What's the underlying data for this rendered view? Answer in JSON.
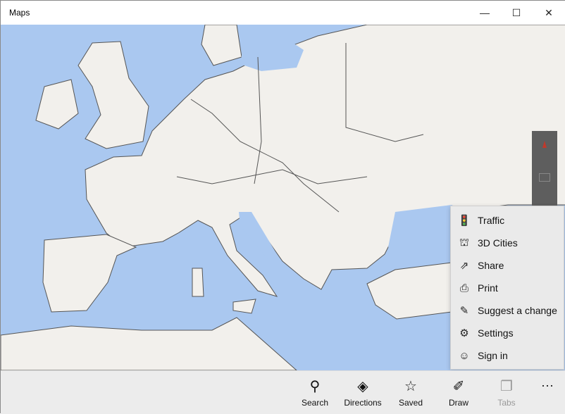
{
  "window": {
    "title": "Maps",
    "minimize": "—",
    "maximize": "☐",
    "close": "✕"
  },
  "colors": {
    "water": "#aac8f0",
    "land": "#f2f0ec",
    "border": "#444444"
  },
  "map_controls": {
    "compass": "compass-icon",
    "tilt": "3d-grid-icon"
  },
  "menu": {
    "items": [
      {
        "label": "Traffic",
        "icon": "traffic-light-icon",
        "glyph": "🚦"
      },
      {
        "label": "3D Cities",
        "icon": "3d-cities-icon",
        "glyph": "⛫"
      },
      {
        "label": "Share",
        "icon": "share-icon",
        "glyph": "⇗"
      },
      {
        "label": "Print",
        "icon": "print-icon",
        "glyph": "⎙"
      },
      {
        "label": "Suggest a change",
        "icon": "suggest-change-icon",
        "glyph": "✎"
      },
      {
        "label": "Settings",
        "icon": "settings-icon",
        "glyph": "⚙"
      },
      {
        "label": "Sign in",
        "icon": "sign-in-icon",
        "glyph": "☺"
      }
    ]
  },
  "toolbar": {
    "items": [
      {
        "label": "Search",
        "icon": "search-icon",
        "glyph": "⚲"
      },
      {
        "label": "Directions",
        "icon": "directions-icon",
        "glyph": "◈"
      },
      {
        "label": "Saved",
        "icon": "saved-icon",
        "glyph": "☆"
      },
      {
        "label": "Draw",
        "icon": "draw-icon",
        "glyph": "✐"
      },
      {
        "label": "Tabs",
        "icon": "tabs-icon",
        "glyph": "❐"
      }
    ],
    "more": "···"
  }
}
